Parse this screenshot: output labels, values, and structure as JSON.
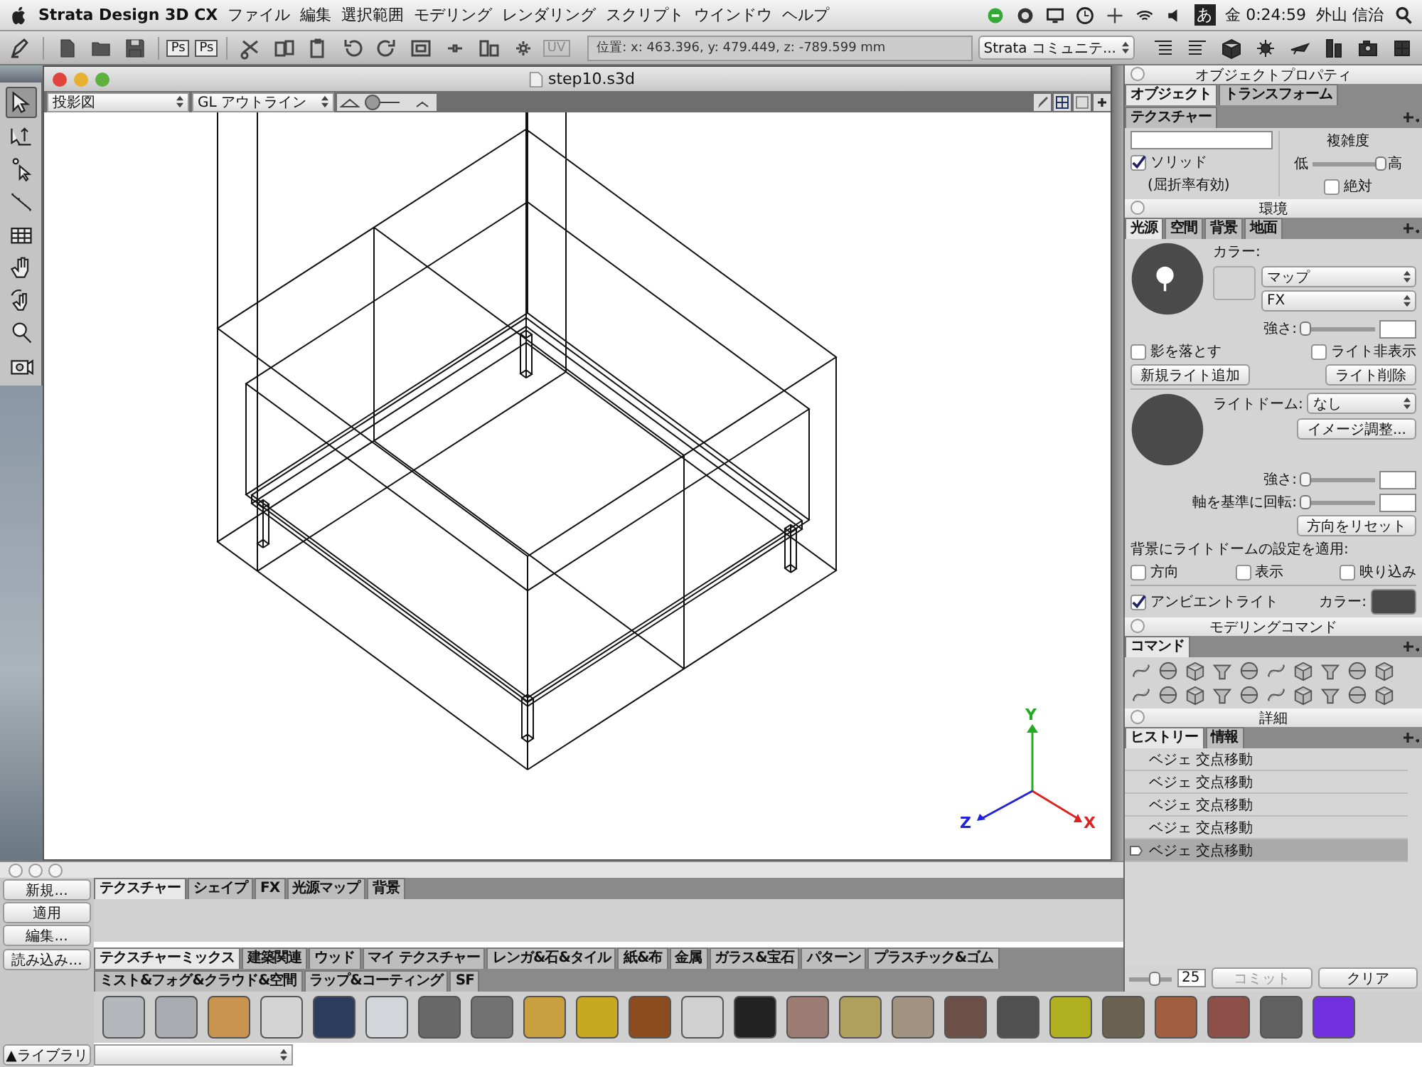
{
  "menu_bar": {
    "app_name": "Strata Design 3D CX",
    "menus": [
      "ファイル",
      "編集",
      "選択範囲",
      "モデリング",
      "レンダリング",
      "スクリプト",
      "ウインドウ",
      "ヘルプ"
    ],
    "input_mode": "あ",
    "clock": "金 0:24:59",
    "user": "外山 信治"
  },
  "toolbar": {
    "ps_buttons": [
      "Ps",
      "Ps"
    ],
    "uv_button": "UV",
    "position": "位置:  x: 463.396,  y: 479.449,  z: -789.599 mm",
    "community": "Strata コミュニテ..."
  },
  "document": {
    "title": "step10.s3d",
    "view_mode": "投影図",
    "render_mode": "GL アウトライン",
    "axes": {
      "x": "X",
      "y": "Y",
      "z": "Z"
    }
  },
  "object_properties": {
    "title": "オブジェクトプロパティ",
    "tabs": [
      {
        "label": "オブジェクト",
        "selected": true
      },
      {
        "label": "トランスフォーム",
        "selected": false
      },
      {
        "label": "テクスチャー",
        "selected": false
      }
    ],
    "complexity_label": "複雑度",
    "low": "低",
    "high": "高",
    "complexity": {
      "level": 0.95
    },
    "solid": {
      "label": "ソリッド",
      "checked": true
    },
    "refraction_note": "(屈折率有効)",
    "absolute": {
      "label": "絶対",
      "checked": false
    }
  },
  "environment": {
    "title": "環境",
    "tabs": [
      {
        "label": "光源",
        "selected": true
      },
      {
        "label": "空間",
        "selected": false
      },
      {
        "label": "背景",
        "selected": false
      },
      {
        "label": "地面",
        "selected": false
      }
    ],
    "color_label": "カラー:",
    "map_select": "マップ",
    "fx_select": "FX",
    "strength_label": "強さ:",
    "strength": {
      "level": 0.05
    },
    "cast_shadow": {
      "label": "影を落とす",
      "checked": false
    },
    "hide_light": {
      "label": "ライト非表示",
      "checked": false
    },
    "add_light": "新規ライト追加",
    "delete_light": "ライト削除",
    "light_dome_label": "ライトドーム:",
    "light_dome_value": "なし",
    "image_adjust": "イメージ調整...",
    "dome_strength_label": "強さ:",
    "dome_strength": {
      "level": 0.05
    },
    "rotate_label": "軸を基準に回転:",
    "rotate": {
      "level": 0.05
    },
    "reset_direction": "方向をリセット",
    "apply_label": "背景にライトドームの設定を適用:",
    "apply_options": [
      {
        "label": "方向",
        "checked": false
      },
      {
        "label": "表示",
        "checked": false
      },
      {
        "label": "映り込み",
        "checked": false
      }
    ],
    "ambient": {
      "label": "アンビエントライト",
      "checked": true
    },
    "ambient_color_label": "カラー:"
  },
  "modeling_commands": {
    "title": "モデリングコマンド",
    "tab": "コマンド"
  },
  "details": {
    "title": "詳細",
    "tabs": [
      {
        "label": "ヒストリー",
        "selected": true
      },
      {
        "label": "情報",
        "selected": false
      }
    ],
    "history": [
      {
        "label": "ベジェ 交点移動",
        "selected": false
      },
      {
        "label": "ベジェ 交点移動",
        "selected": false
      },
      {
        "label": "ベジェ 交点移動",
        "selected": false
      },
      {
        "label": "ベジェ 交点移動",
        "selected": false
      },
      {
        "label": "ベジェ 交点移動",
        "selected": true
      }
    ],
    "slider": {
      "level": 0.6
    },
    "value": "25",
    "commit": {
      "label": "コミット",
      "disabled": true
    },
    "clear": {
      "label": "クリア",
      "disabled": false
    }
  },
  "resource_panel": {
    "buttons": [
      "新規...",
      "適用",
      "編集..."
    ],
    "tabs": [
      {
        "label": "テクスチャー",
        "selected": true
      },
      {
        "label": "シェイプ",
        "selected": false
      },
      {
        "label": "FX",
        "selected": false
      },
      {
        "label": "光源マップ",
        "selected": false
      },
      {
        "label": "背景",
        "selected": false
      }
    ]
  },
  "texture_library": {
    "load_button": "読み込み...",
    "library_button": "▲ライブラリ",
    "tabs": [
      {
        "label": "テクスチャーミックス",
        "selected": true
      },
      {
        "label": "建築関連",
        "selected": false
      },
      {
        "label": "ウッド",
        "selected": false
      },
      {
        "label": "マイ テクスチャー",
        "selected": false
      },
      {
        "label": "レンガ&石&タイル",
        "selected": false
      },
      {
        "label": "紙&布",
        "selected": false
      },
      {
        "label": "金属",
        "selected": false
      },
      {
        "label": "ガラス&宝石",
        "selected": false
      },
      {
        "label": "パターン",
        "selected": false
      },
      {
        "label": "プラスチック&ゴム",
        "selected": false
      },
      {
        "label": "ミスト&フォグ&クラウド&空間",
        "selected": false
      },
      {
        "label": "ラップ&コーティング",
        "selected": false
      },
      {
        "label": "SF",
        "selected": false
      }
    ],
    "swatches": [
      {
        "color": "#b4b8bc"
      },
      {
        "color": "#a8acb0"
      },
      {
        "color": "#c89450"
      },
      {
        "color": "#d4d4d4"
      },
      {
        "color": "#2c3c5c"
      },
      {
        "color": "#d2d6da"
      },
      {
        "color": "#686868"
      },
      {
        "color": "#727272"
      },
      {
        "color": "#c8a040"
      },
      {
        "color": "#c8a820"
      },
      {
        "color": "#8c4c20"
      },
      {
        "color": "#d0d0d0"
      },
      {
        "color": "#222222"
      },
      {
        "color": "#9c7c72"
      },
      {
        "color": "#b0a060"
      },
      {
        "color": "#a29282"
      },
      {
        "color": "#6c5048"
      },
      {
        "color": "#505050"
      },
      {
        "color": "#b0b020"
      },
      {
        "color": "#6c6252"
      },
      {
        "color": "#a06040"
      },
      {
        "color": "#8c5048"
      },
      {
        "color": "#606060"
      },
      {
        "color": "#7030e0"
      }
    ]
  }
}
